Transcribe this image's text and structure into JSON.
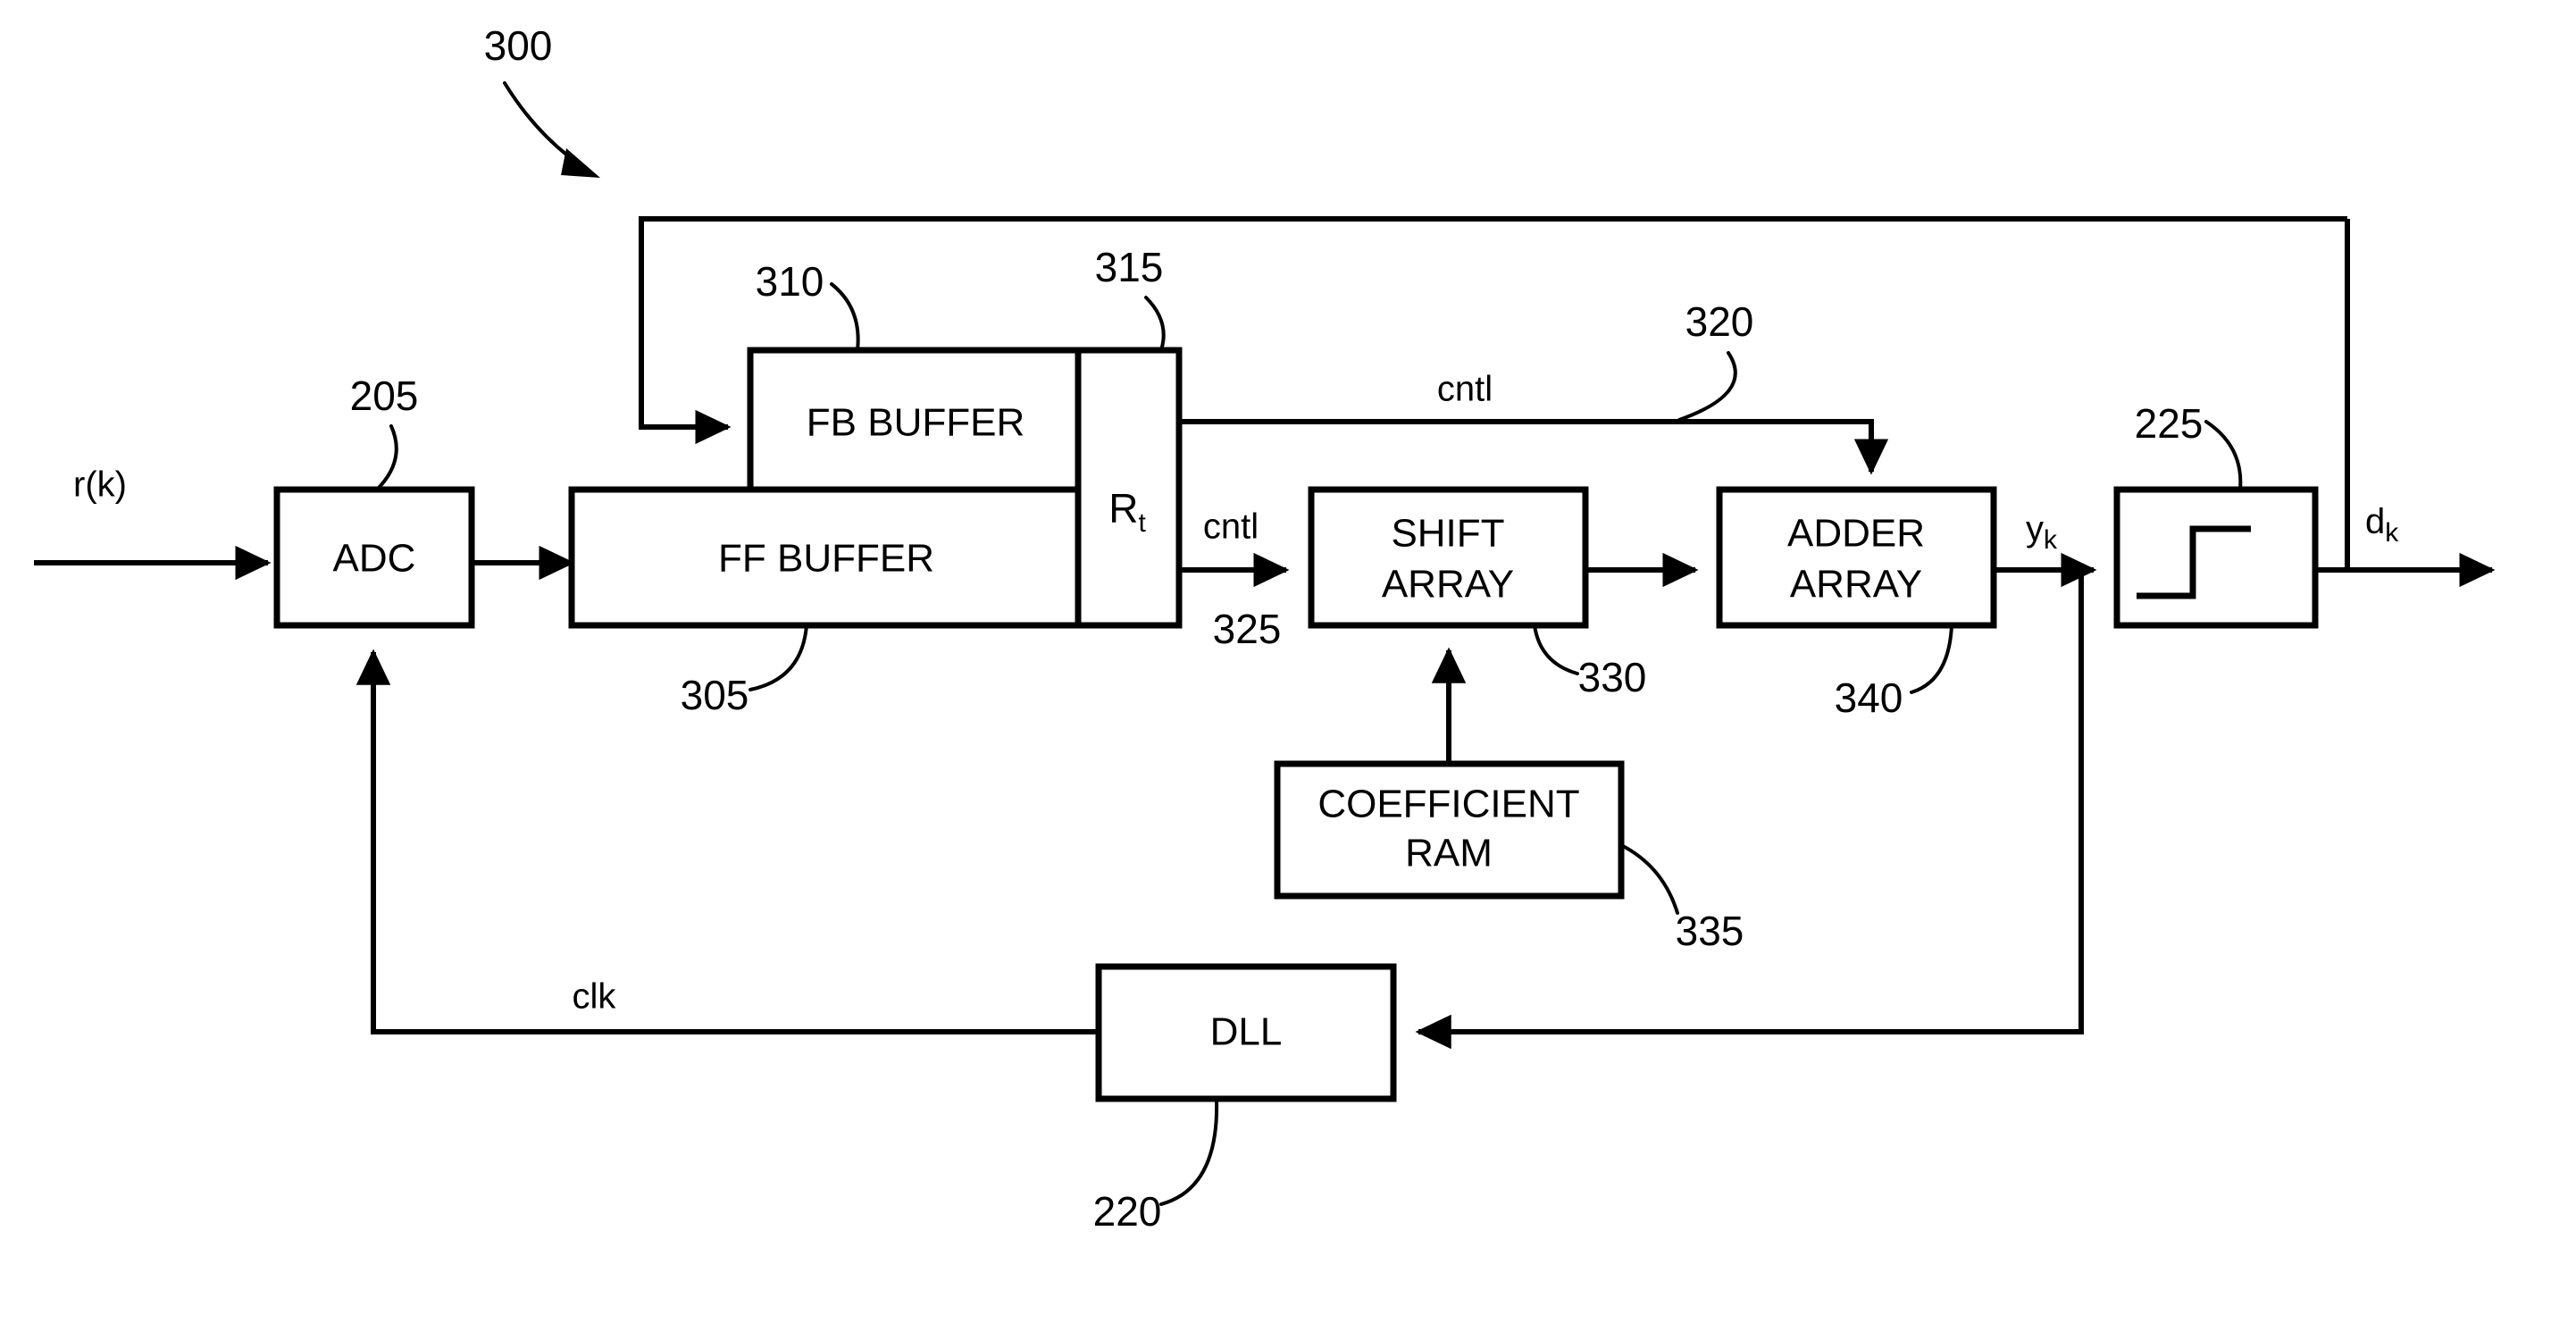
{
  "figure": {
    "figure_ref": "300",
    "blocks": [
      {
        "id": "adc",
        "label": "ADC",
        "ref": "205"
      },
      {
        "id": "fb",
        "label": "FB BUFFER",
        "ref": "310"
      },
      {
        "id": "ff",
        "label": "FF BUFFER",
        "ref": "305"
      },
      {
        "id": "rt",
        "label": "R",
        "label_sub": "t",
        "ref": "315"
      },
      {
        "id": "shift",
        "label_line1": "SHIFT",
        "label_line2": "ARRAY",
        "ref": "330"
      },
      {
        "id": "adder",
        "label_line1": "ADDER",
        "label_line2": "ARRAY",
        "ref": "340"
      },
      {
        "id": "coef",
        "label_line1": "COEFFICIENT",
        "label_line2": "RAM",
        "ref": "335"
      },
      {
        "id": "dll",
        "label": "DLL",
        "ref": "220"
      },
      {
        "id": "slicer",
        "label": "",
        "ref": "225"
      }
    ],
    "signals": {
      "input": "r(k)",
      "cntl_top": "cntl",
      "cntl_mid": "cntl",
      "cntl_mid_ref": "325",
      "cntl_top_ref": "320",
      "adder_out": "y",
      "adder_out_sub": "k",
      "slicer_out": "d",
      "slicer_out_sub": "k",
      "clock": "clk"
    }
  }
}
